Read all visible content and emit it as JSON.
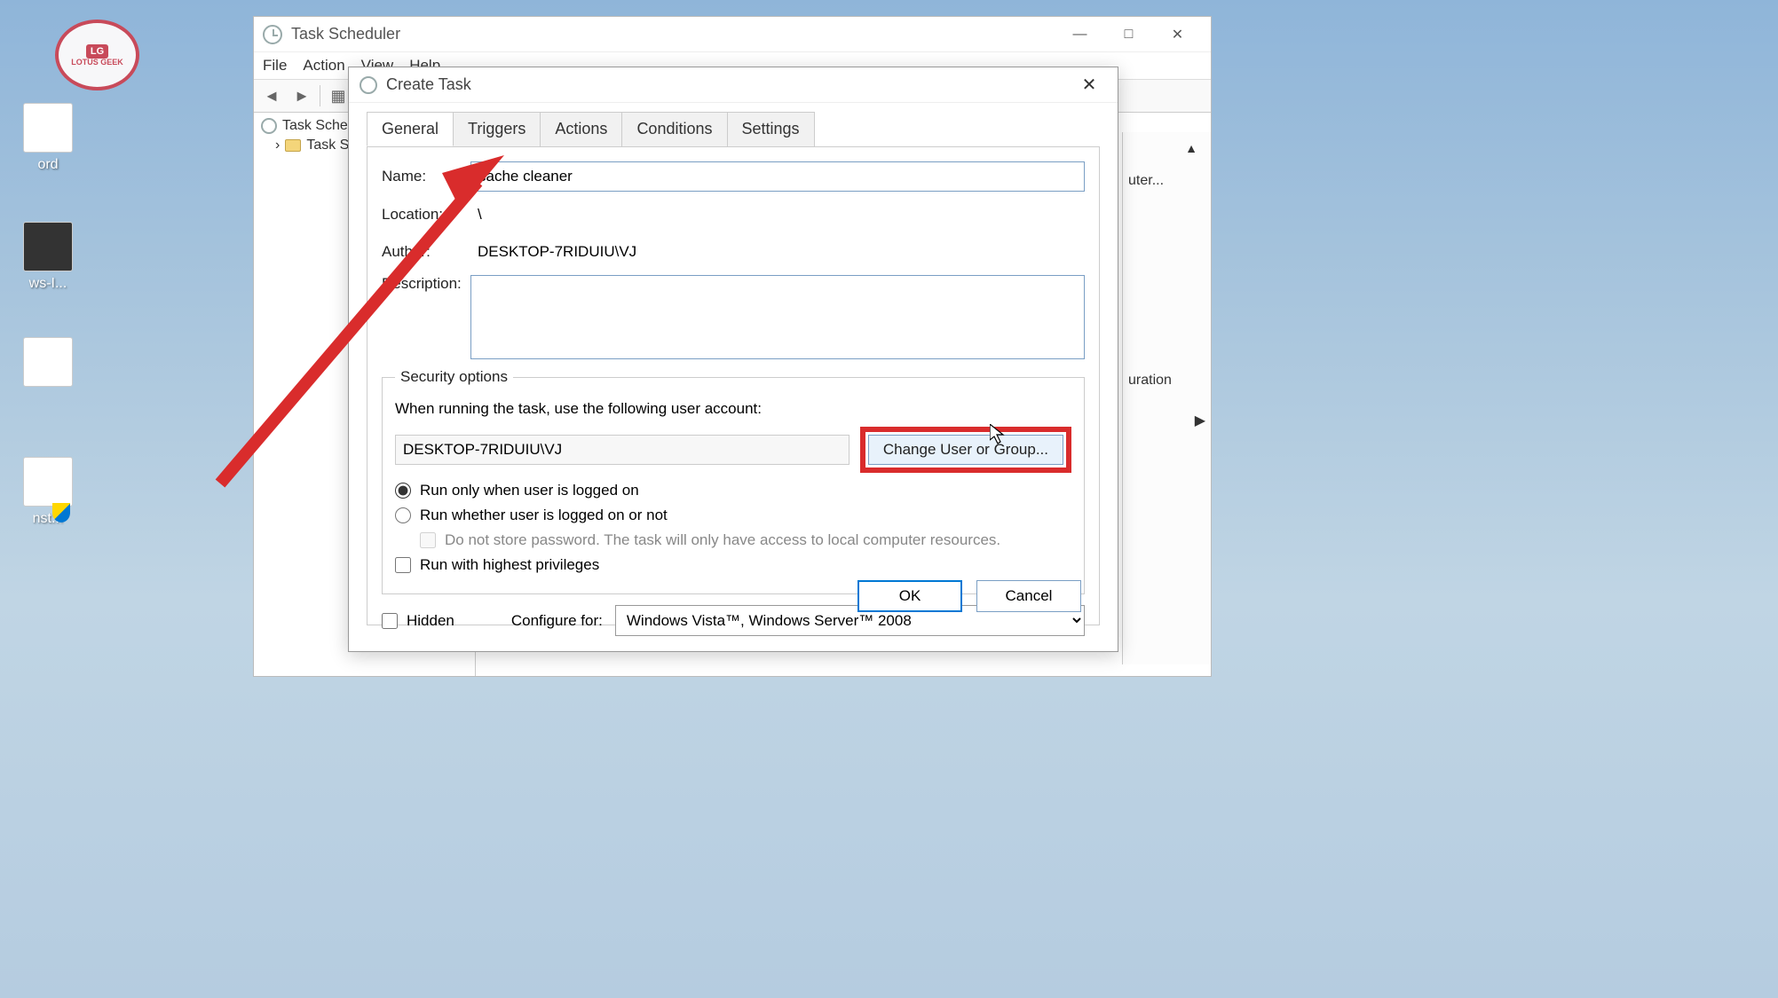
{
  "desktop": {
    "icons": [
      {
        "label": "ord"
      },
      {
        "label": "ws-I..."
      },
      {
        "label": ""
      },
      {
        "label": "nst..."
      }
    ],
    "logo_text": "LOTUS GEEK",
    "logo_lg": "LG"
  },
  "main_window": {
    "title": "Task Scheduler",
    "menu": [
      "File",
      "Action",
      "View",
      "Help"
    ],
    "tree": {
      "root": "Task Scheduler",
      "child": "Task S"
    },
    "actions": {
      "item1": "uter...",
      "item2": "uration"
    }
  },
  "dialog": {
    "title": "Create Task",
    "tabs": [
      "General",
      "Triggers",
      "Actions",
      "Conditions",
      "Settings"
    ],
    "labels": {
      "name": "Name:",
      "location": "Location:",
      "author": "Author:",
      "description": "Description:",
      "security_legend": "Security options",
      "security_text": "When running the task, use the following user account:",
      "change_user": "Change User or Group...",
      "run_logged_on": "Run only when user is logged on",
      "run_whether": "Run whether user is logged on or not",
      "no_password": "Do not store password.  The task will only have access to local computer resources.",
      "highest_priv": "Run with highest privileges",
      "hidden": "Hidden",
      "configure_for": "Configure for:",
      "ok": "OK",
      "cancel": "Cancel"
    },
    "values": {
      "name": "cache cleaner",
      "location": "\\",
      "author": "DESKTOP-7RIDUIU\\VJ",
      "user_account": "DESKTOP-7RIDUIU\\VJ",
      "configure_option": "Windows Vista™, Windows Server™ 2008"
    }
  }
}
